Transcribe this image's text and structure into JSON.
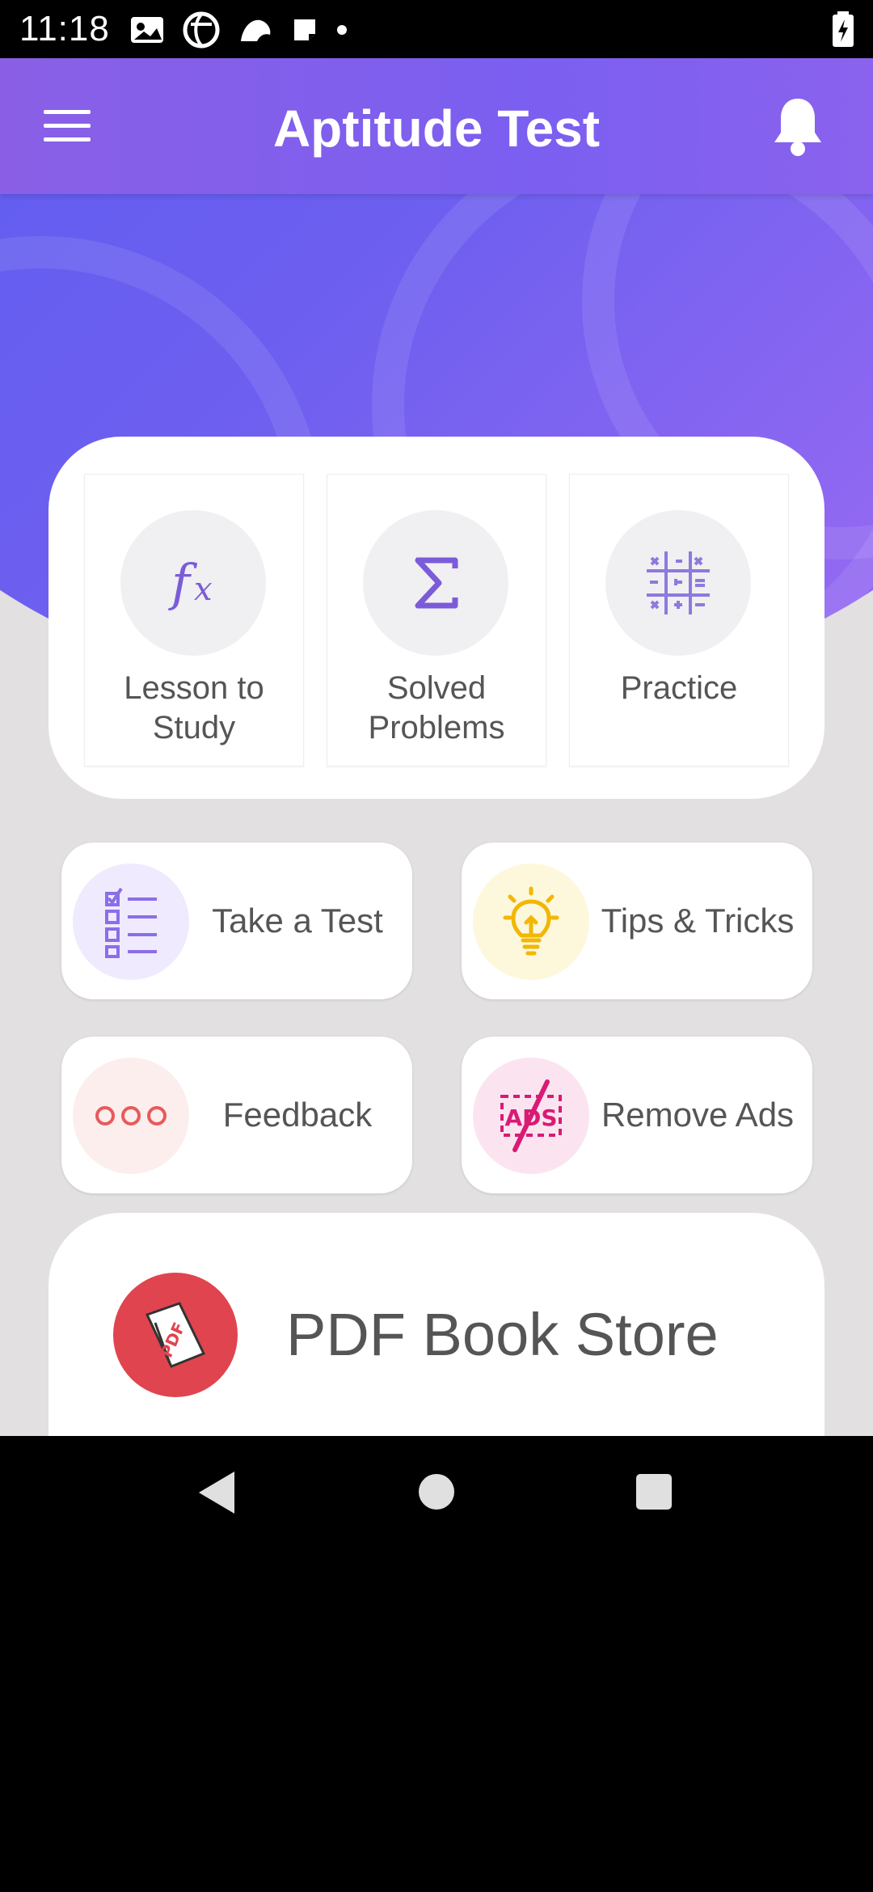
{
  "status_bar": {
    "time": "11:18",
    "notification_icons": [
      "photo-icon",
      "globe-icon",
      "bird-icon",
      "note-icon",
      "dot-icon"
    ],
    "battery_icon": "battery-charging-icon"
  },
  "app_bar": {
    "title": "Aptitude Test",
    "menu_icon": "hamburger-menu-icon",
    "notification_icon": "bell-icon"
  },
  "study_tiles": [
    {
      "label": "Lesson to Study",
      "icon": "function-fx-icon"
    },
    {
      "label": "Solved Problems",
      "icon": "sigma-icon"
    },
    {
      "label": "Practice",
      "icon": "math-symbols-icon"
    }
  ],
  "action_buttons": [
    {
      "label": "Take a Test",
      "icon": "checklist-icon",
      "icon_bg": "#efeafd",
      "icon_color": "#8b6ee8"
    },
    {
      "label": "Tips & Tricks",
      "icon": "lightbulb-icon",
      "icon_bg": "#fdf8dc",
      "icon_color": "#f2b705"
    },
    {
      "label": "Feedback",
      "icon": "ellipsis-icon",
      "icon_bg": "#fdeeee",
      "icon_color": "#e85a5a"
    },
    {
      "label": "Remove Ads",
      "icon": "no-ads-icon",
      "icon_bg": "#fbe4f0",
      "icon_color": "#d81b74"
    }
  ],
  "pdf_store": {
    "label": "PDF Book Store",
    "icon_text": "PDF",
    "icon_bg": "#e0444f"
  },
  "colors": {
    "accent": "#7b5ff0",
    "tile_icon": "#7b5bd9",
    "background": "#e2e0e1"
  },
  "nav_bar": [
    "back-icon",
    "home-icon",
    "recents-icon"
  ]
}
